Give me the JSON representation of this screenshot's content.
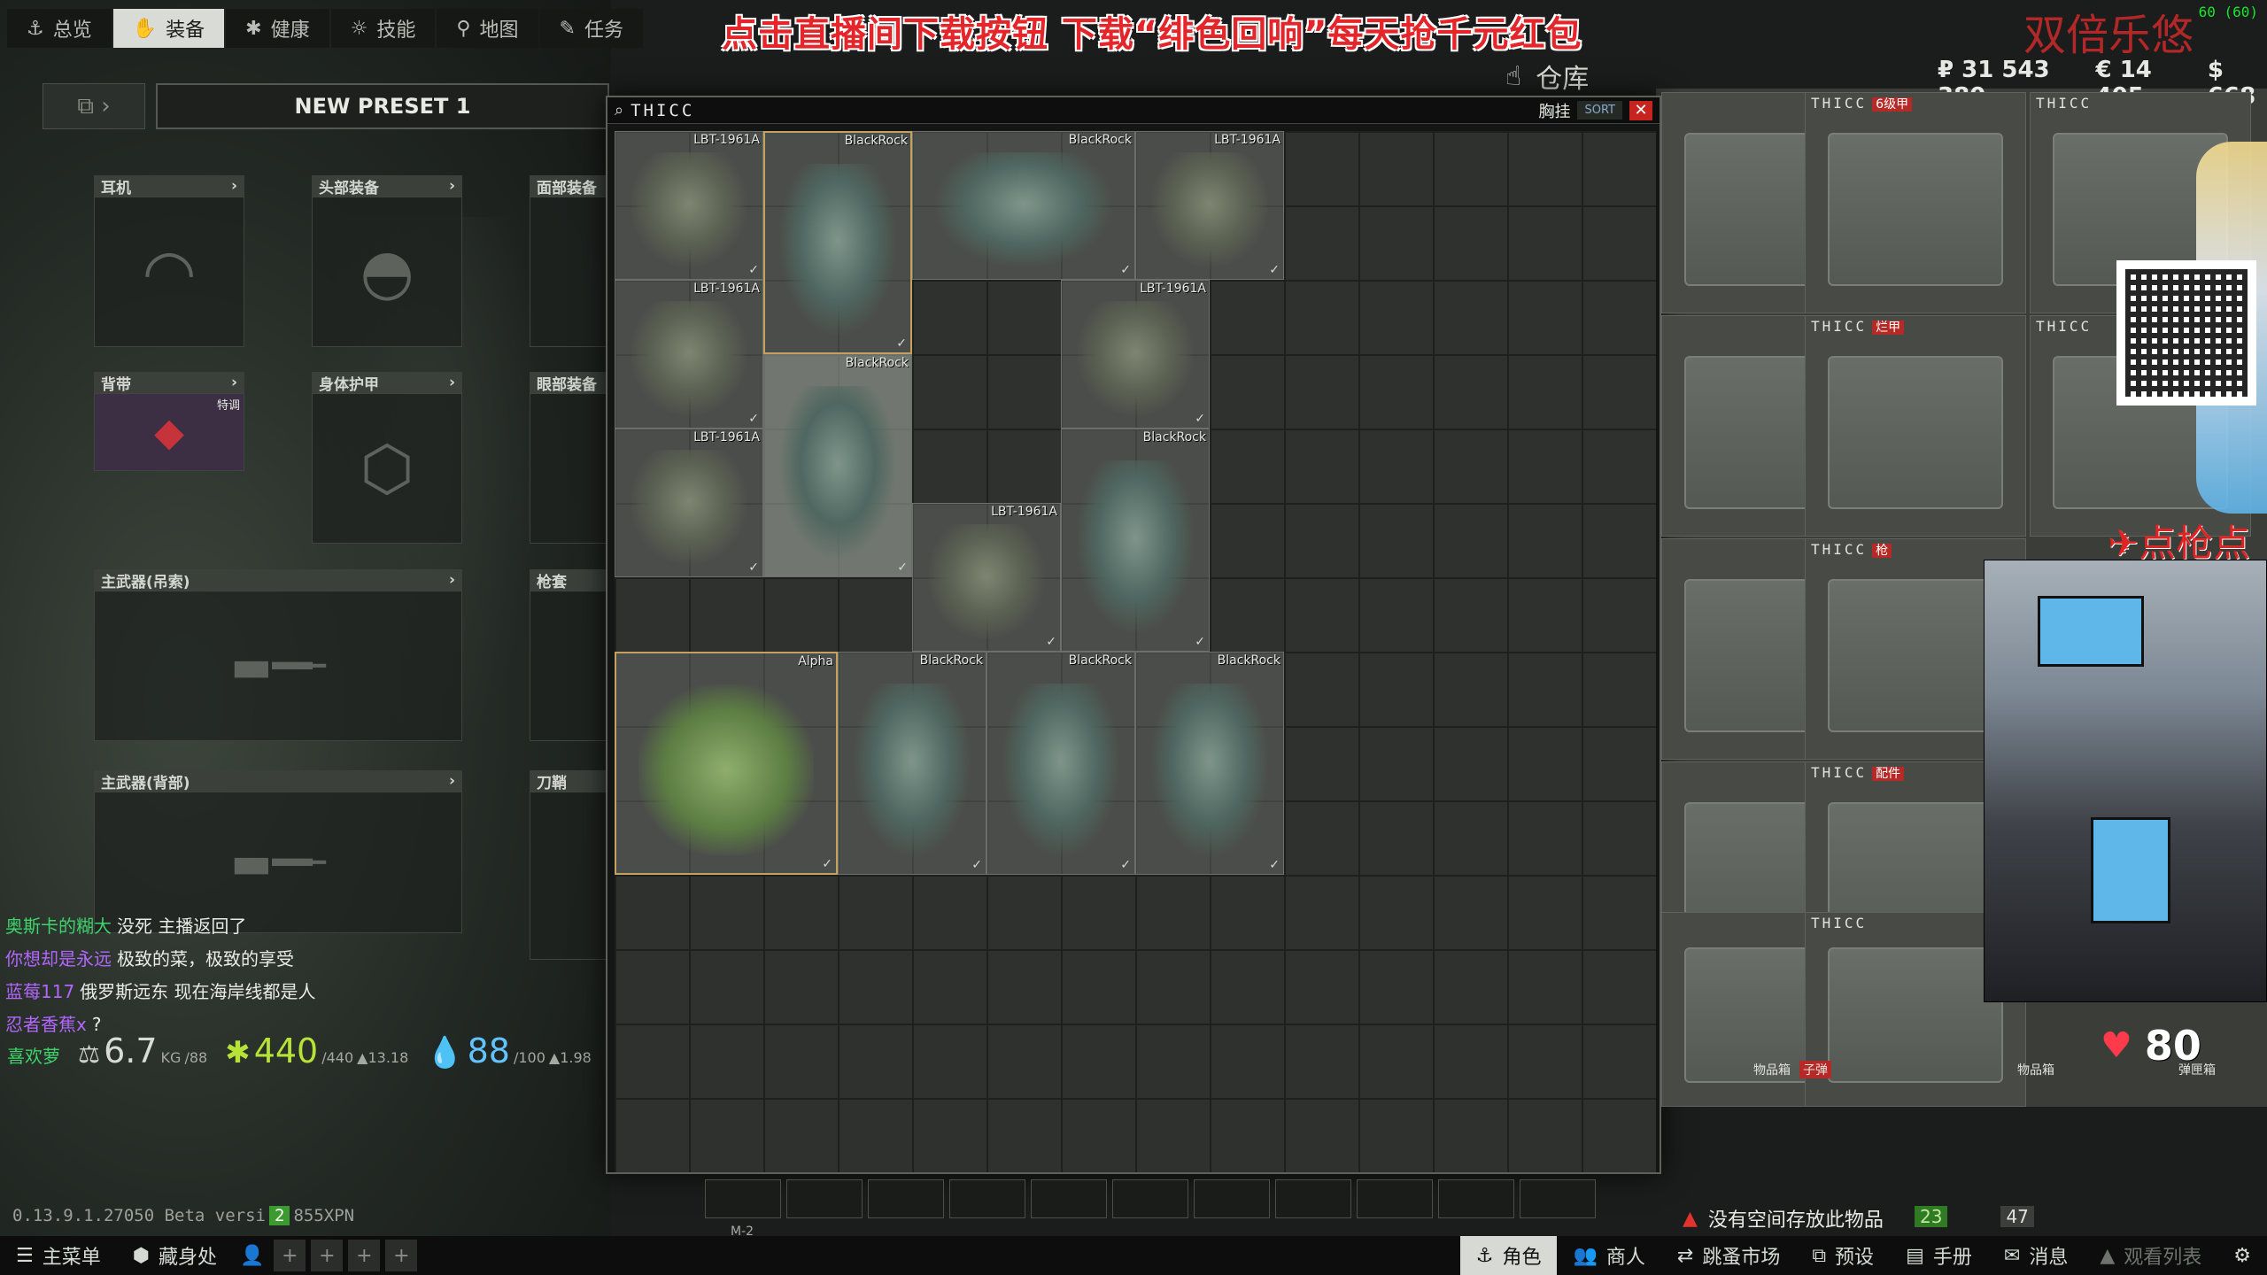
{
  "overlay": {
    "promo_banner": "点击直播间下载按钮 下载“绯色回响”每天抢千元红包",
    "top_right_text": "双倍乐悠",
    "fps": "60 (60)",
    "mid_right_text": "点枪点图",
    "heart_rate": "80"
  },
  "nav": {
    "tabs": [
      {
        "label": "总览",
        "icon": "anchor-icon"
      },
      {
        "label": "装备",
        "icon": "hand-icon"
      },
      {
        "label": "健康",
        "icon": "medical-icon"
      },
      {
        "label": "技能",
        "icon": "sun-icon"
      },
      {
        "label": "地图",
        "icon": "map-pin-icon"
      },
      {
        "label": "任务",
        "icon": "notepad-icon"
      }
    ],
    "active_index": 1
  },
  "stash": {
    "title": "仓库",
    "currencies": [
      "₽ 31 543 380",
      "€ 14 405",
      "$ 668"
    ],
    "boxes": [
      {
        "label": "THICC",
        "tag": "6级甲"
      },
      {
        "label": "THICC",
        "tag": ""
      },
      {
        "label": "THICC",
        "tag": "烂甲"
      },
      {
        "label": "THICC",
        "tag": ""
      },
      {
        "label": "THICC",
        "tag": "枪"
      },
      {
        "label": "THICC",
        "tag": ""
      },
      {
        "label": "THICC",
        "tag": "配件"
      },
      {
        "label": "",
        "tag": ""
      },
      {
        "label": "THICC",
        "tag": ""
      },
      {
        "label": "",
        "tag": ""
      }
    ],
    "case_labels": [
      "物品箱",
      "子弹",
      "物品箱",
      "弹匣箱"
    ]
  },
  "preset": {
    "name": "NEW PRESET 1"
  },
  "slots": {
    "earpiece": "耳机",
    "headwear": "头部装备",
    "face": "面部装备",
    "armband": "背带",
    "armband_tag": "特调",
    "armor": "身体护甲",
    "eyewear": "眼部装备",
    "primary_sling": "主武器(吊索)",
    "holster": "枪套",
    "primary_back": "主武器(背部)",
    "scabbard": "刀鞘"
  },
  "chat": [
    {
      "user": "奥斯卡的糊大",
      "msg": "没死 主播返回了",
      "color": "green"
    },
    {
      "user": "你想却是永远",
      "msg": "极致的菜，极致的享受",
      "color": "purple"
    },
    {
      "user": "蓝莓117",
      "msg": "俄罗斯远东 现在海岸线都是人",
      "color": "purple"
    },
    {
      "user": "忍者香蕉x",
      "msg": "?",
      "color": "purple"
    },
    {
      "user": "喜欢萝",
      "msg": "",
      "color": "green"
    }
  ],
  "stats": {
    "weight": "6.7",
    "weight_unit": "KG",
    "weight_max": "/88",
    "energy": "440",
    "energy_max": "/440",
    "energy_rate": "▲13.18",
    "hydration": "88",
    "hydration_max": "/100",
    "hydration_rate": "▲1.98"
  },
  "container": {
    "title": "THICC",
    "category": "胸挂",
    "sort_label": "SORT",
    "items": [
      {
        "name": "LBT-1961A",
        "kind": "rig"
      },
      {
        "name": "BlackRock",
        "kind": "plate"
      },
      {
        "name": "BlackRock",
        "kind": "plate"
      },
      {
        "name": "LBT-1961A",
        "kind": "rig"
      },
      {
        "name": "LBT-1961A",
        "kind": "rig"
      },
      {
        "name": "LBT-1961A",
        "kind": "rig"
      },
      {
        "name": "BlackRock",
        "kind": "plate"
      },
      {
        "name": "LBT-1961A",
        "kind": "rig"
      },
      {
        "name": "LBT-1961A",
        "kind": "rig"
      },
      {
        "name": "BlackRock",
        "kind": "plate"
      },
      {
        "name": "Alpha",
        "kind": "vest"
      },
      {
        "name": "BlackRock",
        "kind": "plate"
      },
      {
        "name": "BlackRock",
        "kind": "plate"
      },
      {
        "name": "BlackRock",
        "kind": "plate"
      }
    ]
  },
  "version": {
    "text": "0.13.9.1.27050 Beta versi",
    "badge": "2",
    "suffix": "855XPN"
  },
  "quickslots": {
    "label": "M-2"
  },
  "warning": {
    "text": "没有空间存放此物品",
    "count_a": "23",
    "count_b": "47"
  },
  "bottom_bar": {
    "menu": "主菜单",
    "hideout": "藏身处",
    "character": "角色",
    "traders": "商人",
    "flea": "跳蚤市场",
    "presets": "预设",
    "handbook": "手册",
    "messages": "消息",
    "watchlist": "观看列表"
  }
}
